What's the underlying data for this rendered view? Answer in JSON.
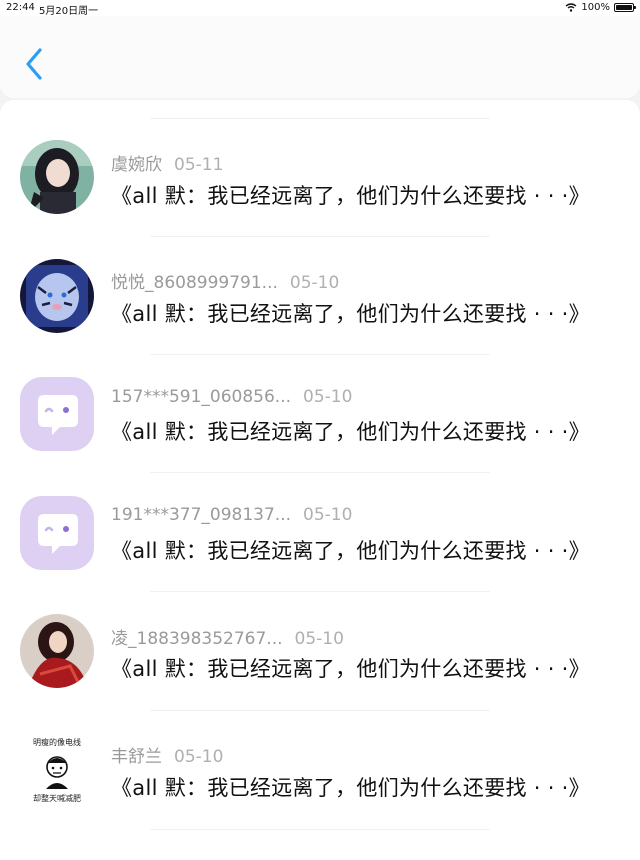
{
  "status_bar": {
    "time": "22:44",
    "date": "5月20日周一",
    "battery": "100%"
  },
  "nav": {
    "back_icon": "chevron-left-icon",
    "accent": "#2a9df4"
  },
  "rows": [
    {
      "name": "虞婉欣",
      "date": "05-11",
      "message": "《all 默：我已经远离了，他们为什么还要找 · · ·》",
      "avatar": "photo"
    },
    {
      "name": "悦悦_8608999791...",
      "date": "05-10",
      "message": "《all 默：我已经远离了，他们为什么还要找 · · ·》",
      "avatar": "tiger-photo"
    },
    {
      "name": "157***591_060856...",
      "date": "05-10",
      "message": "《all 默：我已经远离了，他们为什么还要找 · · ·》",
      "avatar": "chat-bubble-icon"
    },
    {
      "name": "191***377_098137...",
      "date": "05-10",
      "message": "《all 默：我已经远离了，他们为什么还要找 · · ·》",
      "avatar": "chat-bubble-icon"
    },
    {
      "name": "凌_188398352767...",
      "date": "05-10",
      "message": "《all 默：我已经远离了，他们为什么还要找 · · ·》",
      "avatar": "photo"
    },
    {
      "name": "丰舒兰",
      "date": "05-10",
      "message": "《all 默：我已经远离了，他们为什么还要找 · · ·》",
      "avatar": "meme",
      "avatar_text_top": "明瘦的像电线",
      "avatar_text_bottom": "却整天喊减肥"
    }
  ]
}
